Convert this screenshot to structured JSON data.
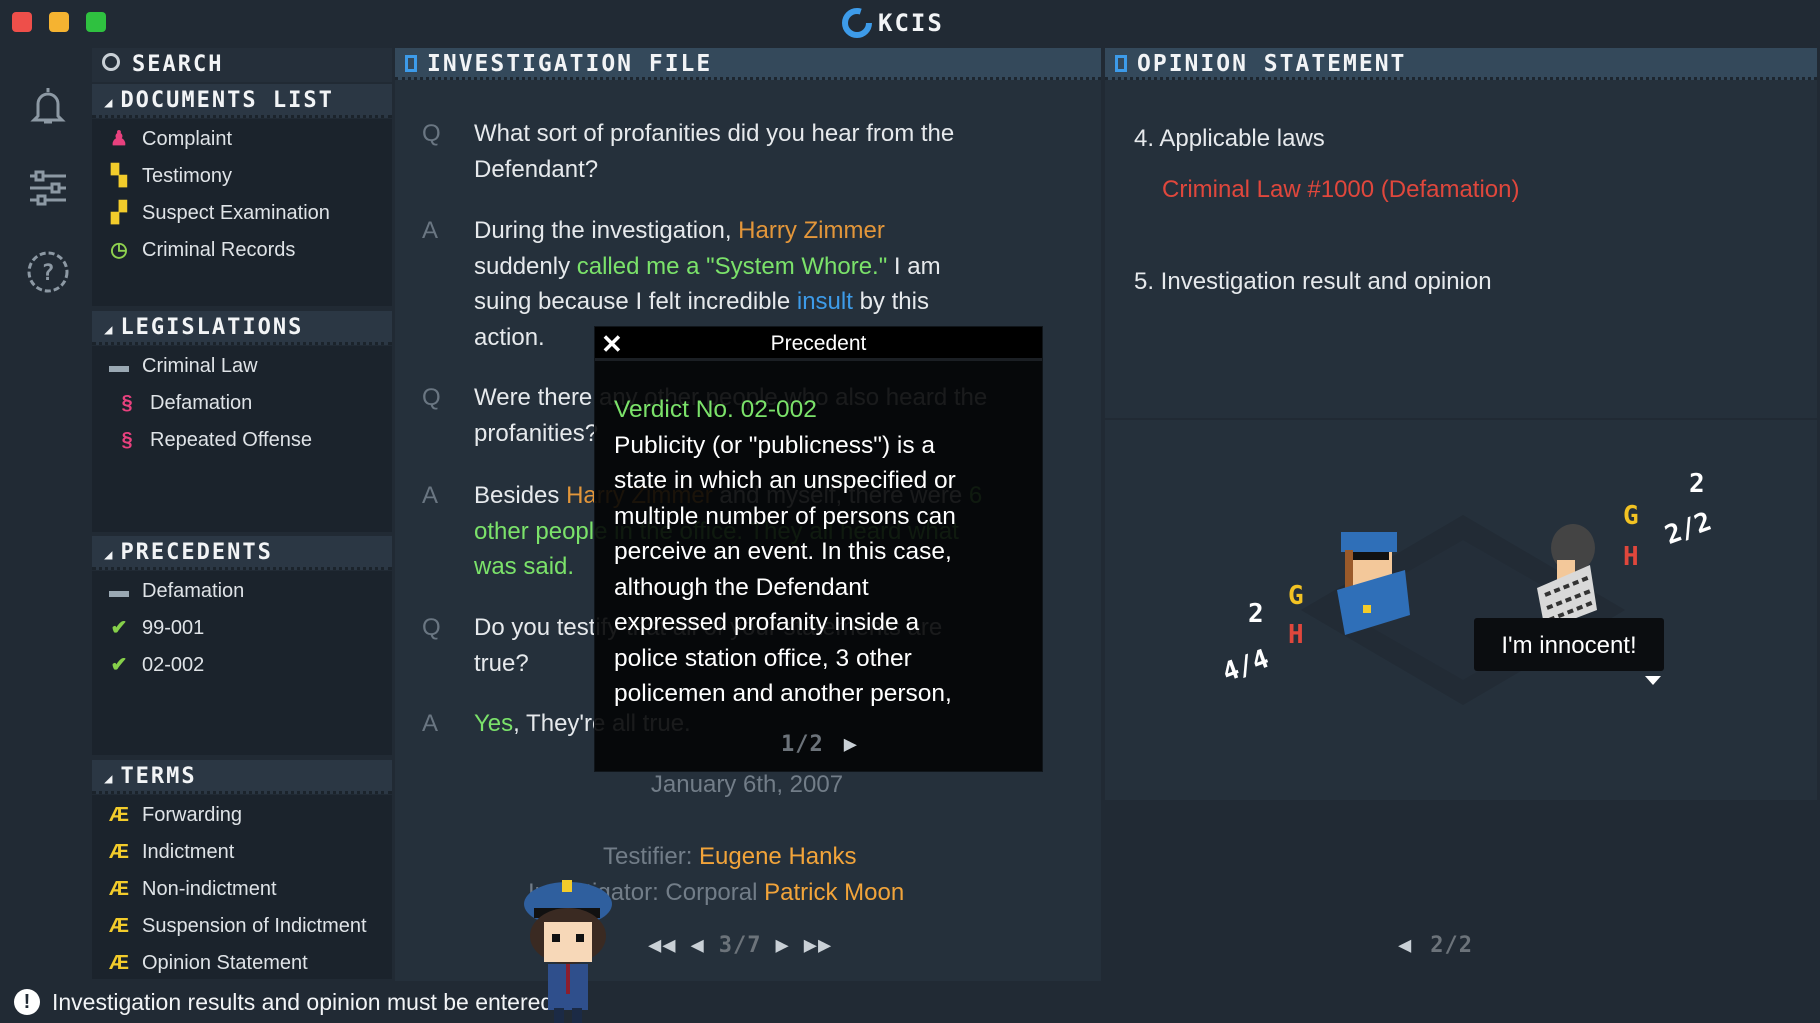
{
  "window": {
    "title": "KCIS",
    "traffic_lights": [
      "#ee4f4a",
      "#f5b331",
      "#2fc140"
    ]
  },
  "rail": {
    "icons": [
      "bell-icon",
      "sliders-icon",
      "help-icon"
    ]
  },
  "sidebar": {
    "search_label": "Search",
    "sections": [
      {
        "title": "Documents List",
        "items": [
          {
            "label": "Complaint",
            "icon": "complaint-icon",
            "color": "#e8417e"
          },
          {
            "label": "Testimony",
            "icon": "testimony-icon",
            "color": "#f3cc2b"
          },
          {
            "label": "Suspect Examination",
            "icon": "suspect-examination-icon",
            "color": "#f3cc2b"
          },
          {
            "label": "Criminal Records",
            "icon": "criminal-records-icon",
            "color": "#8fd14f"
          }
        ]
      },
      {
        "title": "Legislations",
        "items": [
          {
            "label": "Criminal Law",
            "icon": "folder-icon",
            "color": "#9aa8b3"
          },
          {
            "label": "Defamation",
            "icon": "section-icon",
            "color": "#e8417e",
            "sub": true
          },
          {
            "label": "Repeated Offense",
            "icon": "section-icon",
            "color": "#e8417e",
            "sub": true
          }
        ]
      },
      {
        "title": "Precedents",
        "items": [
          {
            "label": "Defamation",
            "icon": "folder-icon",
            "color": "#9aa8b3"
          },
          {
            "label": "99-001",
            "icon": "check-icon",
            "color": "#86d04a"
          },
          {
            "label": "02-002",
            "icon": "check-icon",
            "color": "#86d04a"
          }
        ]
      },
      {
        "title": "Terms",
        "items": [
          {
            "label": "Forwarding",
            "icon": "term-icon",
            "color": "#f3cc2b"
          },
          {
            "label": "Indictment",
            "icon": "term-icon",
            "color": "#f3cc2b"
          },
          {
            "label": "Non-indictment",
            "icon": "term-icon",
            "color": "#f3cc2b"
          },
          {
            "label": "Suspension of Indictment",
            "icon": "term-icon",
            "color": "#f3cc2b"
          },
          {
            "label": "Opinion Statement",
            "icon": "term-icon",
            "color": "#f3cc2b"
          }
        ]
      }
    ]
  },
  "investigation": {
    "title": "Investigation File",
    "qa": [
      {
        "tag": "Q",
        "lines": [
          [
            {
              "t": "What sort of profanities did you hear from the"
            }
          ],
          [
            {
              "t": "Defendant?"
            }
          ]
        ]
      },
      {
        "tag": "A",
        "lines": [
          [
            {
              "t": "During the investigation, "
            },
            {
              "t": "Harry Zimmer",
              "c": "#e3963a"
            }
          ],
          [
            {
              "t": "suddenly "
            },
            {
              "t": "called me a \"System Whore.\"",
              "c": "#7be26a"
            },
            {
              "t": " I am"
            }
          ],
          [
            {
              "t": "suing because I felt incredible "
            },
            {
              "t": "insult",
              "c": "#3d9be9"
            },
            {
              "t": " by this"
            }
          ],
          [
            {
              "t": "action."
            }
          ]
        ]
      },
      {
        "tag": "Q",
        "lines": [
          [
            {
              "t": "Were there any other people who also heard the"
            }
          ],
          [
            {
              "t": "profanities?"
            }
          ]
        ]
      },
      {
        "tag": "A",
        "lines": [
          [
            {
              "t": "Besides "
            },
            {
              "t": "Harry Zimmer",
              "c": "#e3963a"
            },
            {
              "t": " and myself, there were "
            },
            {
              "t": "6",
              "c": "#7be26a"
            }
          ],
          [
            {
              "t": "other people in the office. They all heard what",
              "c": "#7be26a"
            }
          ],
          [
            {
              "t": "was said.",
              "c": "#7be26a"
            }
          ]
        ]
      },
      {
        "tag": "Q",
        "lines": [
          [
            {
              "t": "Do you testify that all of your statements are"
            }
          ],
          [
            {
              "t": "true?"
            }
          ]
        ]
      },
      {
        "tag": "A",
        "lines": [
          [
            {
              "t": "Yes",
              "c": "#7be26a"
            },
            {
              "t": ", They're all true."
            }
          ]
        ]
      }
    ],
    "date": "January 6th, 2007",
    "testifier_label": "Testifier: ",
    "testifier": "Eugene Hanks",
    "investigator_label": "Investigator: Corporal ",
    "investigator": "Patrick Moon",
    "pager": "3/7"
  },
  "popup": {
    "title": "Precedent",
    "verdict": "Verdict No. 02-002",
    "lines": [
      "Publicity (or \"publicness\") is a",
      "state in which an unspecified or",
      "multiple number of persons can",
      "perceive an event. In this case,",
      "although the Defendant",
      "expressed profanity inside a",
      "police station office, 3 other",
      "policemen and another person,"
    ],
    "pager": "1/2"
  },
  "opinion": {
    "title": "Opinion Statement",
    "item4": "4. Applicable laws",
    "law": "Criminal Law #1000 (Defamation)",
    "item5": "5. Investigation result and opinion",
    "pager": "2/2",
    "scene": {
      "speech": "I'm innocent!",
      "left_stats": {
        "g": "G",
        "h": "H",
        "top": "2",
        "bottom": "4/4"
      },
      "right_stats": {
        "g": "G",
        "h": "H",
        "top": "2",
        "bottom": "2/2"
      }
    }
  },
  "status": {
    "message": "Investigation results and opinion must be entered."
  }
}
